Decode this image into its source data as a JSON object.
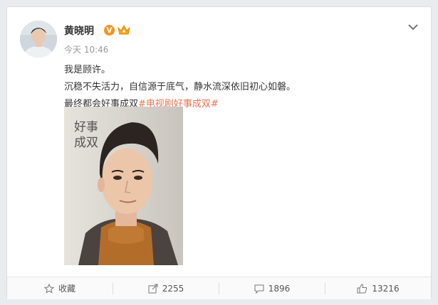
{
  "post": {
    "author": "黄晓明",
    "verified_badge": "V",
    "time": "今天 10:46",
    "lines": [
      "我是顾许。",
      "沉稳不失活力，自信源于底气，静水流深依旧初心如磐。"
    ],
    "line3_text": "最终都会好事成双",
    "hashtag": "#电视剧好事成双#",
    "poster_title": "好事成双"
  },
  "actions": {
    "favorite": "收藏",
    "share": "2255",
    "comment": "1896",
    "like": "13216"
  },
  "colors": {
    "link": "#eb7350",
    "badge": "#f7931e",
    "background": "#e9ecef"
  },
  "icons": [
    "avatar",
    "verified-badge",
    "crown-icon",
    "chevron-down-icon",
    "star-icon",
    "share-icon",
    "comment-icon",
    "thumb-up-icon"
  ]
}
